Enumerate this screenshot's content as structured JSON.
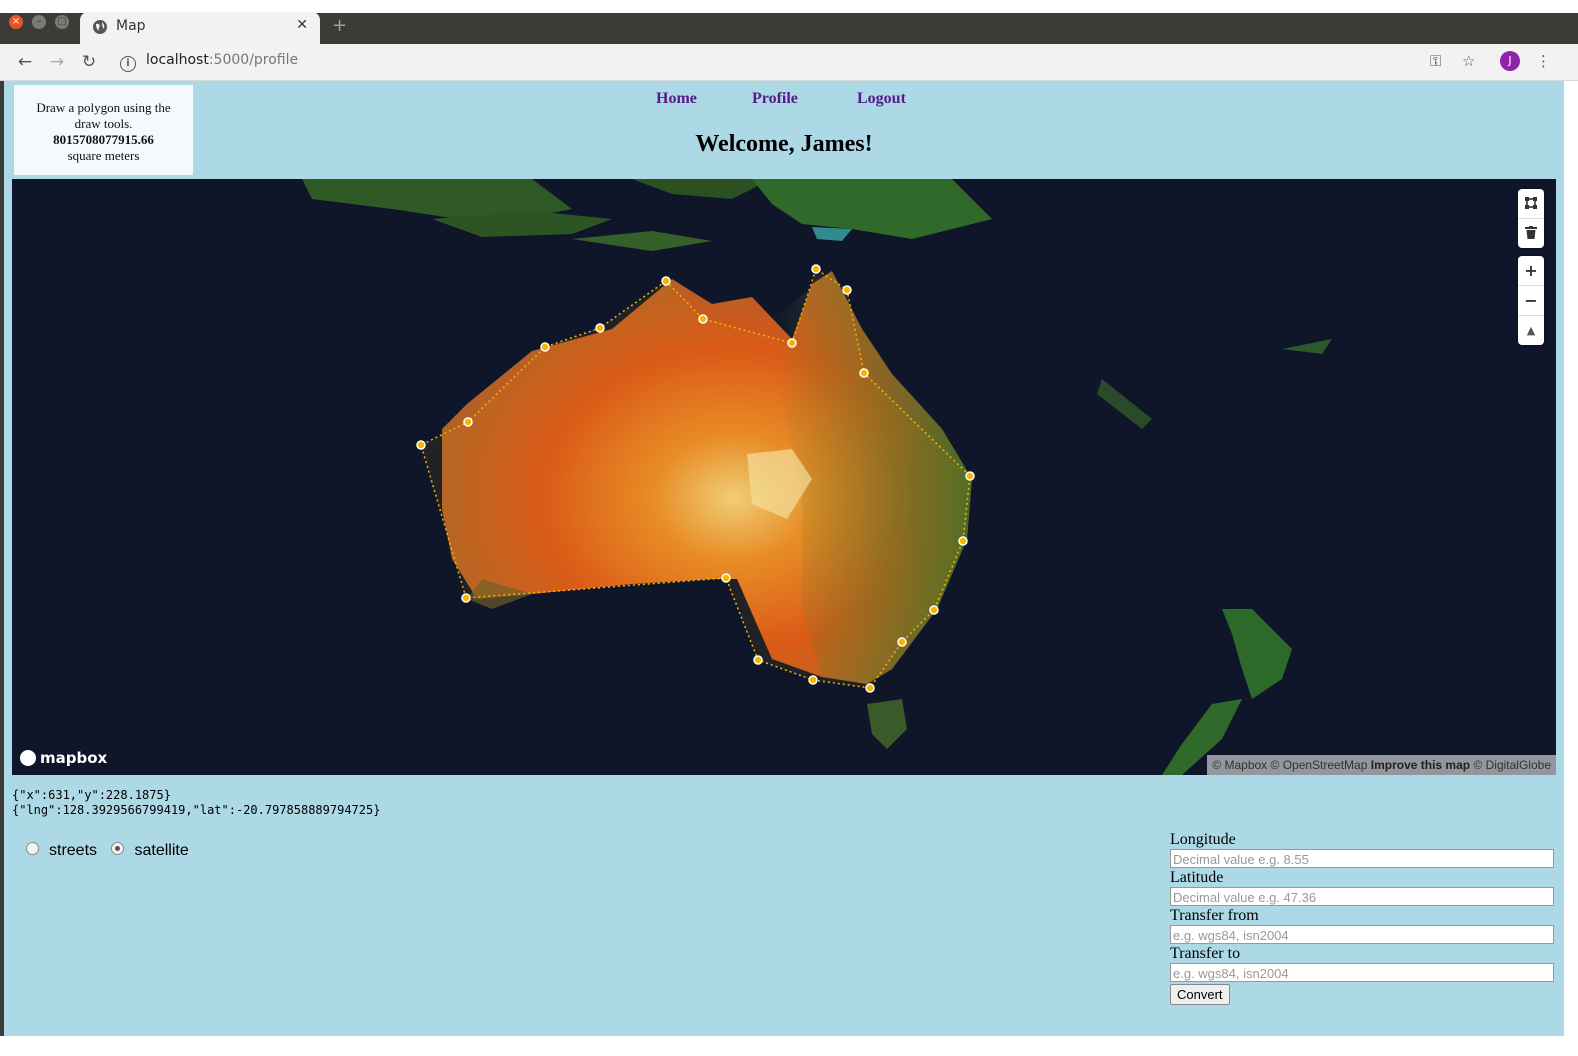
{
  "browser": {
    "tab_title": "Map",
    "tab_close": "✕",
    "new_tab": "+",
    "url_host": "localhost",
    "url_path": ":5000/profile",
    "avatar_letter": "J"
  },
  "info_box": {
    "text": "Draw a polygon using the draw tools.",
    "area_value": "8015708077915.66",
    "unit": "square meters"
  },
  "nav": {
    "home": "Home",
    "profile": "Profile",
    "logout": "Logout"
  },
  "welcome": "Welcome, James!",
  "map": {
    "controls": {
      "draw_polygon_icon": "polygon-icon",
      "trash_icon": "trash-icon",
      "zoom_in": "+",
      "zoom_out": "−",
      "compass": "▲"
    },
    "logo": "mapbox",
    "attribution": {
      "part1": "© Mapbox © OpenStreetMap",
      "improve": "Improve this map",
      "part2": "© DigitalGlobe"
    },
    "polygon_color": "#f7b500"
  },
  "debug": {
    "point": "{\"x\":631,\"y\":228.1875}",
    "lnglat": "{\"lng\":128.3929566799419,\"lat\":-20.797858889794725}"
  },
  "styles": {
    "options": [
      {
        "label": "streets",
        "checked": false
      },
      {
        "label": "satellite",
        "checked": true
      }
    ]
  },
  "form": {
    "longitude_label": "Longitude",
    "longitude_placeholder": "Decimal value e.g. 8.55",
    "latitude_label": "Latitude",
    "latitude_placeholder": "Decimal value e.g. 47.36",
    "from_label": "Transfer from",
    "from_placeholder": "e.g. wgs84, isn2004",
    "to_label": "Transfer to",
    "to_placeholder": "e.g. wgs84, isn2004",
    "convert": "Convert"
  }
}
